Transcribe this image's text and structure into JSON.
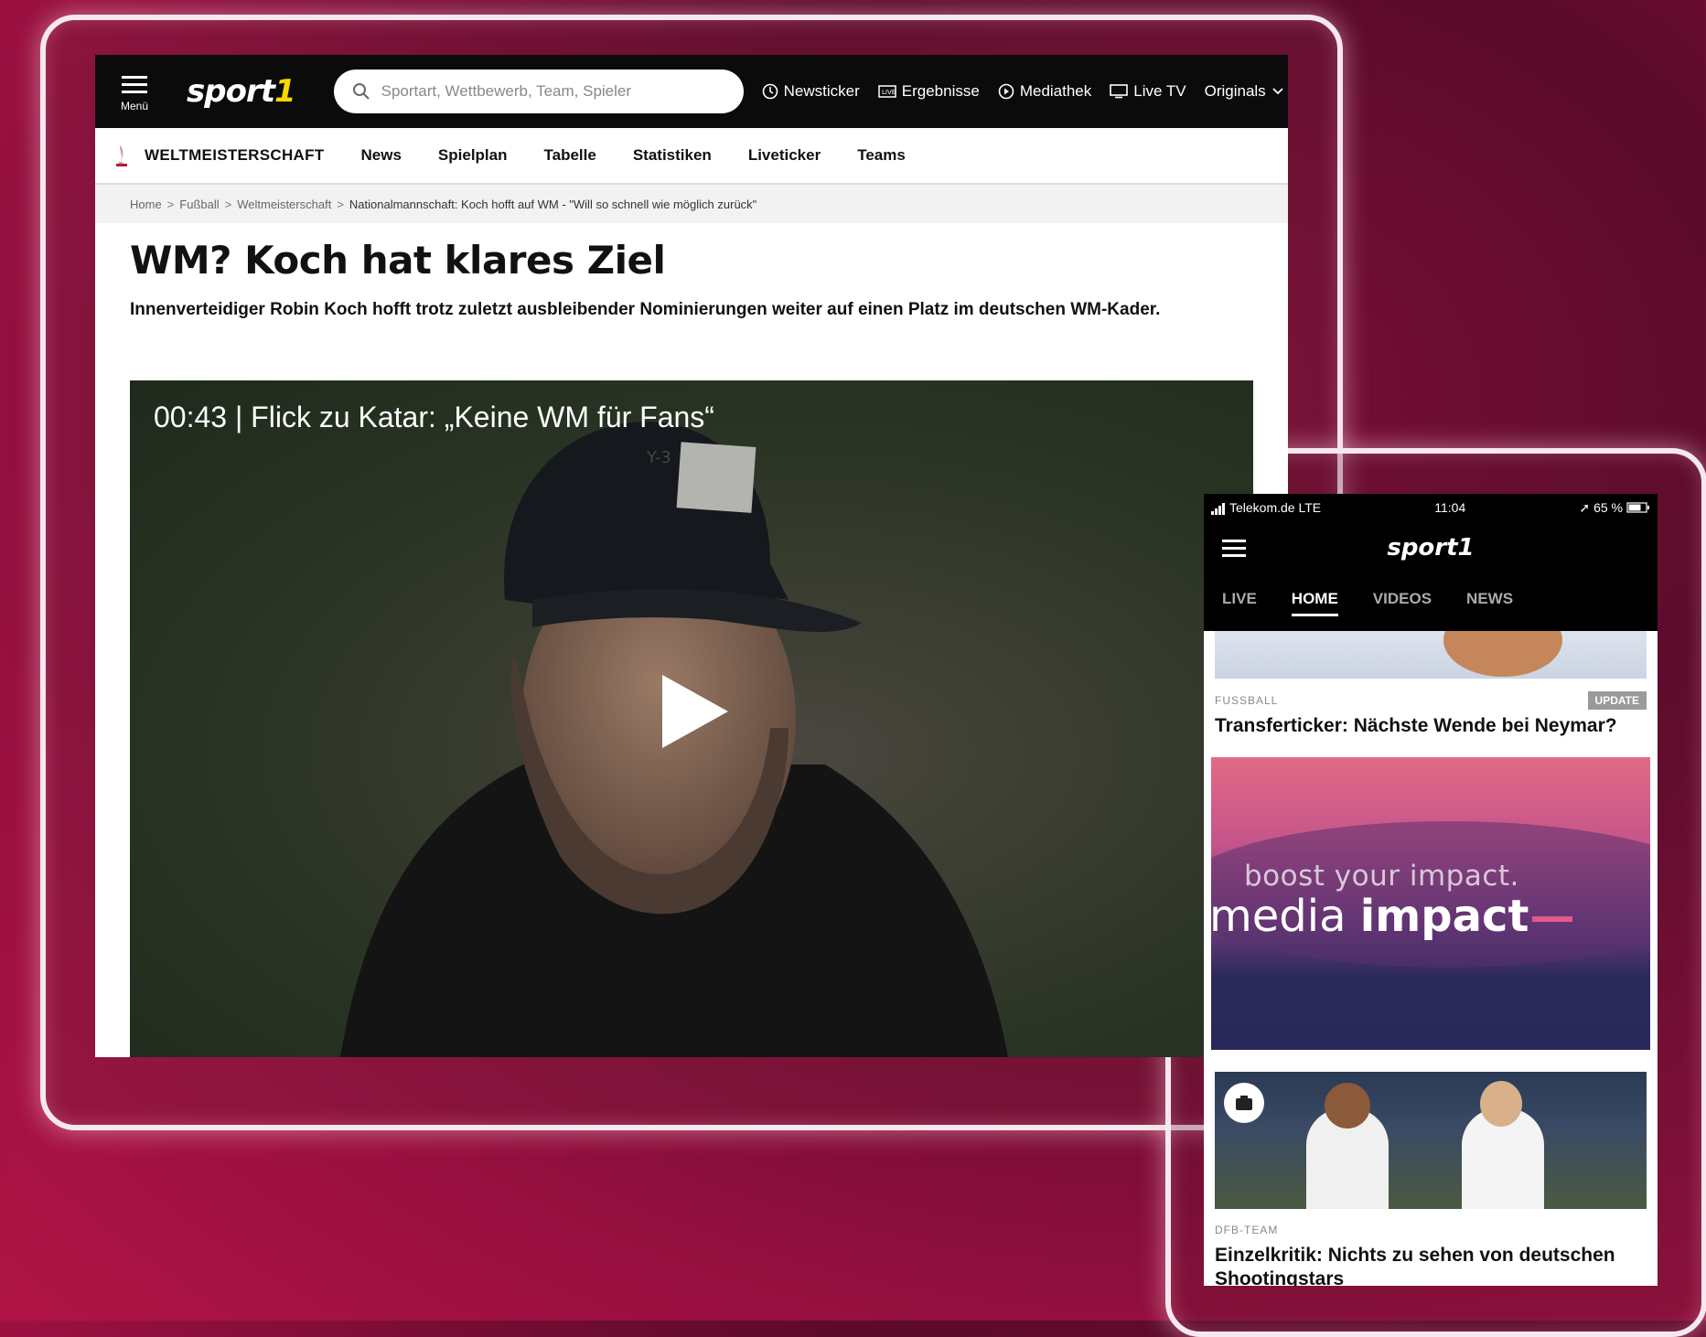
{
  "desktop": {
    "menu_label": "Menü",
    "logo": {
      "main": "sport",
      "accent": "1"
    },
    "search": {
      "placeholder": "Sportart, Wettbewerb, Team, Spieler"
    },
    "top_links": [
      {
        "label": "Newsticker",
        "icon": "clock-icon"
      },
      {
        "label": "Ergebnisse",
        "icon": "live-scores-icon"
      },
      {
        "label": "Mediathek",
        "icon": "play-circle-icon"
      },
      {
        "label": "Live TV",
        "icon": "tv-icon"
      },
      {
        "label": "Originals",
        "icon": "chevron-down-icon"
      }
    ],
    "subnav": {
      "section": "WELTMEISTERSCHAFT",
      "items": [
        "News",
        "Spielplan",
        "Tabelle",
        "Statistiken",
        "Liveticker",
        "Teams"
      ]
    },
    "breadcrumb": [
      "Home",
      "Fußball",
      "Weltmeisterschaft",
      "Nationalmannschaft: Koch hofft auf WM - \"Will so schnell wie möglich zurück\""
    ],
    "headline": "WM? Koch hat klares Ziel",
    "teaser": "Innenverteidiger Robin Koch hofft trotz zuletzt ausbleibender Nominierungen weiter auf einen Platz im deutschen WM-Kader.",
    "video": {
      "title": "00:43 | Flick zu Katar: „Keine WM für Fans“",
      "cap_text": "Y-3"
    }
  },
  "mobile": {
    "status": {
      "carrier": "Telekom.de LTE",
      "time": "11:04",
      "battery": "65 %"
    },
    "logo": {
      "main": "sport",
      "accent": "1"
    },
    "tabs": [
      {
        "label": "LIVE",
        "active": false
      },
      {
        "label": "HOME",
        "active": true
      },
      {
        "label": "VIDEOS",
        "active": false
      },
      {
        "label": "NEWS",
        "active": false
      }
    ],
    "article1": {
      "category": "FUSSBALL",
      "badge": "UPDATE",
      "headline": "Transferticker: Nächste Wende bei Neymar?"
    },
    "ad": {
      "line1": "boost your impact.",
      "line2a": "media ",
      "line2b": "impact"
    },
    "article2": {
      "category": "DFB-TEAM",
      "headline": "Einzelkritik: Nichts zu sehen von deutschen Shootingstars"
    }
  },
  "colors": {
    "accent": "#ffd500",
    "header_bg": "#0b0b0b",
    "background": "#8a1038"
  }
}
